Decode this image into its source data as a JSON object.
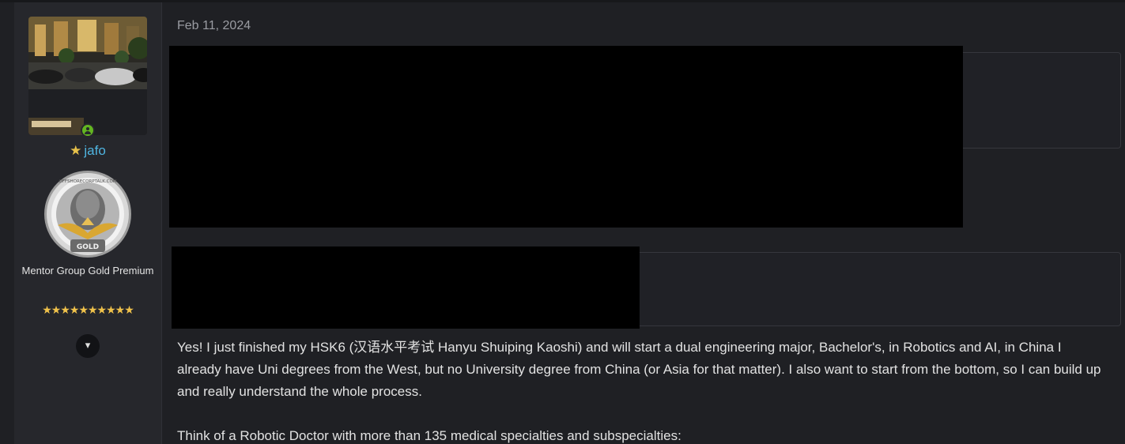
{
  "post": {
    "date": "Feb 11, 2024",
    "paragraphs": [
      "Yes! I just finished my HSK6 (汉语水平考试 Hanyu Shuiping Kaoshi) and will start a dual engineering major, Bachelor's, in Robotics and AI, in China I already have Uni degrees from the West, but no University degree from China (or Asia for that matter). I also want to start from the bottom, so I can build up and really understand the whole process.",
      "Think of a Robotic Doctor with more than 135 medical specialties and subspecialties:"
    ]
  },
  "user": {
    "username": "jafo",
    "title": "Mentor Group Gold Premium",
    "stars": "★★★★★★★★★★",
    "status_icon": "online-user-icon",
    "badge": {
      "icon": "gold-mentor-badge-icon",
      "top_text": "OFFSHORECORPTALK.COM",
      "bottom_text": "GOLD"
    }
  },
  "icons": {
    "rank": "star-icon",
    "expand": "chevron-down-icon"
  },
  "colors": {
    "background": "#1f2024",
    "sidebar": "#26272c",
    "username": "#4fb4e0",
    "stars": "#f0c24b",
    "online": "#63b521"
  }
}
